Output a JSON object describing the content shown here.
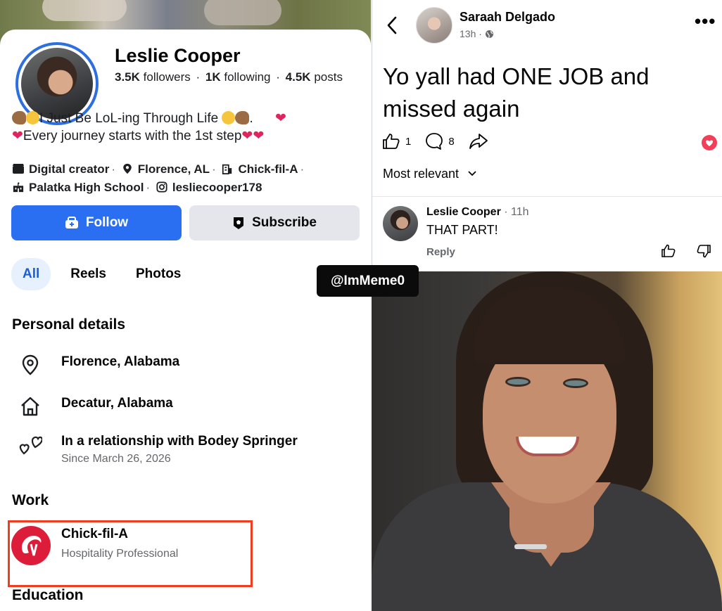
{
  "profile": {
    "name": "Leslie Cooper",
    "followers_count": "3.5K",
    "followers_label": "followers",
    "following_count": "1K",
    "following_label": "following",
    "posts_count": "4.5K",
    "posts_label": "posts",
    "bio_line1": "I Just Be LoL-ing Through Life",
    "bio_line2": "Every journey starts with the 1st step",
    "meta": {
      "role": "Digital creator",
      "location": "Florence, AL",
      "work": "Chick-fil-A",
      "school": "Palatka High School",
      "instagram": "lesliecooper178"
    },
    "follow_label": "Follow",
    "subscribe_label": "Subscribe",
    "tabs": [
      {
        "label": "All",
        "active": true
      },
      {
        "label": "Reels",
        "active": false
      },
      {
        "label": "Photos",
        "active": false
      }
    ],
    "personal_details_title": "Personal details",
    "details": {
      "current_city": "Florence, Alabama",
      "hometown": "Decatur, Alabama",
      "relationship": "In a relationship with Bodey Springer",
      "relationship_since": "Since March 26, 2026"
    },
    "work_title": "Work",
    "work": {
      "employer": "Chick-fil-A",
      "position": "Hospitality Professional"
    },
    "education_title": "Education"
  },
  "post": {
    "author": "Saraah Delgado",
    "time": "13h",
    "text": "Yo yall had ONE JOB and missed again",
    "like_count": "1",
    "comment_count": "8",
    "sort_label": "Most relevant",
    "comment": {
      "author": "Leslie Cooper",
      "time": "11h",
      "text": "THAT PART!",
      "reply_label": "Reply"
    }
  },
  "watermark": "@ImMeme0",
  "colors": {
    "follow_blue": "#2a6ff2",
    "highlight_red": "#f03d1f",
    "chickfila_red": "#dd1c3a",
    "love_red": "#f33e58"
  }
}
